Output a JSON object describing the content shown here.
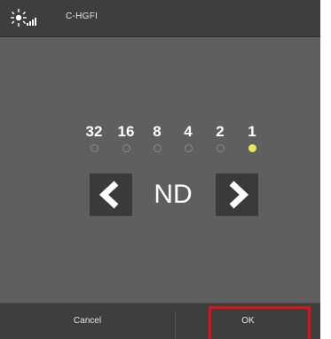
{
  "header": {
    "device_name": "C-HGFI",
    "status_icon": "light-signal-icon"
  },
  "nd_selector": {
    "steps": [
      {
        "value": "32",
        "active": false
      },
      {
        "value": "16",
        "active": false
      },
      {
        "value": "8",
        "active": false
      },
      {
        "value": "4",
        "active": false
      },
      {
        "value": "2",
        "active": false
      },
      {
        "value": "1",
        "active": true
      }
    ],
    "mode_label": "ND",
    "prev_icon": "chevron-left-icon",
    "next_icon": "chevron-right-icon"
  },
  "footer": {
    "cancel_label": "Cancel",
    "ok_label": "OK"
  },
  "colors": {
    "header_bg": "#3e3e3e",
    "panel_bg": "#5f5f5f",
    "active_dot": "#e8e85a",
    "highlight": "#e0101a"
  }
}
